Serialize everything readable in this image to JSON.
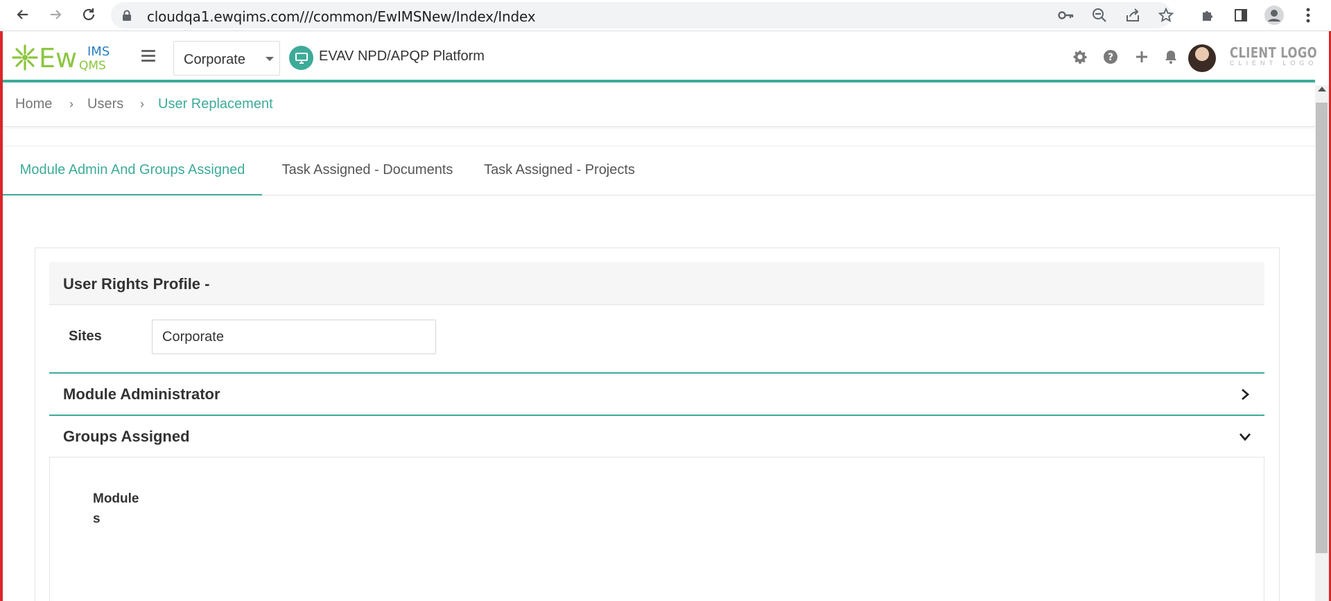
{
  "browser": {
    "url": "cloudqa1.ewqims.com///common/EwIMSNew/Index/Index",
    "back_icon": "arrow-left-icon",
    "forward_icon": "arrow-right-icon",
    "reload_icon": "reload-icon",
    "lock_icon": "lock-icon",
    "url_icons": [
      "key-icon",
      "zoom-out-icon",
      "share-icon",
      "star-icon"
    ],
    "right_icons": [
      "puzzle-icon",
      "side-panel-icon",
      "profile-icon",
      "kebab-menu-icon"
    ]
  },
  "header": {
    "logo_text": "EwIMS QMS",
    "site_selector": "Corporate",
    "platform_name": "EVAV NPD/APQP Platform",
    "icons": [
      "gear-icon",
      "help-icon",
      "plus-icon",
      "bell-icon"
    ],
    "client_logo_big": "CLIENT LOGO",
    "client_logo_small": "CLIENT LOGO",
    "accent_color": "#3dab99"
  },
  "breadcrumb": {
    "items": [
      "Home",
      "Users",
      "User Replacement"
    ],
    "separator": "›"
  },
  "tabs": [
    {
      "label": "Module Admin And Groups Assigned",
      "active": true
    },
    {
      "label": "Task Assigned - Documents",
      "active": false
    },
    {
      "label": "Task Assigned - Projects",
      "active": false
    }
  ],
  "profile": {
    "title": "User Rights Profile -",
    "sites_label": "Sites",
    "sites_value": "Corporate"
  },
  "accordion": [
    {
      "title": "Module Administrator",
      "expanded": false,
      "icon": "chevron-right-icon"
    },
    {
      "title": "Groups Assigned",
      "expanded": true,
      "icon": "chevron-down-icon"
    }
  ],
  "groups": {
    "modules_label": "Modules"
  }
}
